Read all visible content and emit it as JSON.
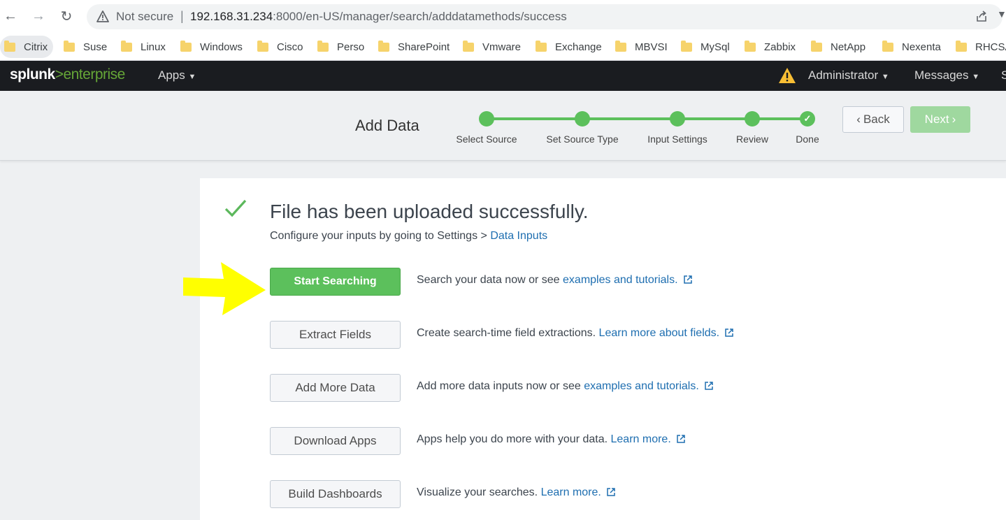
{
  "browser": {
    "not_secure": "Not secure",
    "separator": "|",
    "url_host": "192.168.31.234",
    "url_rest": ":8000/en-US/manager/search/adddatamethods/success",
    "bookmarks": [
      "Citrix",
      "Suse",
      "Linux",
      "Windows",
      "Cisco",
      "Perso",
      "SharePoint",
      "Vmware",
      "Exchange",
      "MBVSI",
      "MySql",
      "Zabbix",
      "NetApp",
      "Nexenta",
      "RHCSA"
    ]
  },
  "header": {
    "logo_splunk": "splunk",
    "logo_gt": ">",
    "logo_enterprise": "enterprise",
    "apps": "Apps",
    "admin": "Administrator",
    "messages": "Messages",
    "cut_text": "S"
  },
  "wizard": {
    "title": "Add Data",
    "steps": [
      "Select Source",
      "Set Source Type",
      "Input Settings",
      "Review",
      "Done"
    ],
    "back": "Back",
    "next": "Next"
  },
  "main": {
    "success_title": "File has been uploaded successfully.",
    "config_text": "Configure your inputs by going to Settings > ",
    "config_link": "Data Inputs",
    "actions": [
      {
        "button": "Start Searching",
        "text": "Search your data now or see ",
        "link": "examples and tutorials."
      },
      {
        "button": "Extract Fields",
        "text": "Create search-time field extractions. ",
        "link": "Learn more about fields."
      },
      {
        "button": "Add More Data",
        "text": "Add more data inputs now or see ",
        "link": "examples and tutorials."
      },
      {
        "button": "Download Apps",
        "text": "Apps help you do more with your data. ",
        "link": "Learn more."
      },
      {
        "button": "Build Dashboards",
        "text": "Visualize your searches. ",
        "link": "Learn more."
      }
    ]
  },
  "colors": {
    "splunk_green": "#5cc05c",
    "link_blue": "#1e6eb0",
    "annotation_arrow": "#ffff00"
  }
}
